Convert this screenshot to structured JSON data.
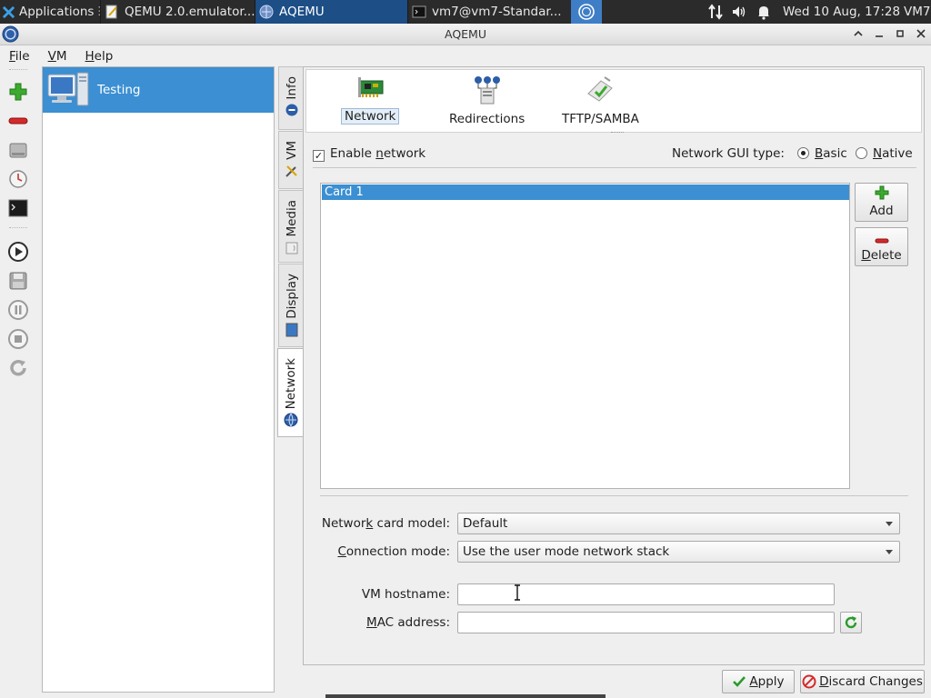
{
  "taskbar": {
    "apps_label": "Applications",
    "apps_extra": "☰",
    "tasks": [
      {
        "label": "QEMU 2.0.emulator..."
      },
      {
        "label": "AQEMU"
      },
      {
        "label": "vm7@vm7-Standar..."
      }
    ],
    "clock": "Wed 10 Aug, 17:28",
    "user": "VM7"
  },
  "window": {
    "title": "AQEMU"
  },
  "menu": {
    "file": {
      "pre": "",
      "key": "F",
      "post": "ile"
    },
    "vm": {
      "pre": "",
      "key": "V",
      "post": "M"
    },
    "help": {
      "pre": "",
      "key": "H",
      "post": "elp"
    }
  },
  "vm_list": {
    "items": [
      {
        "name": "Testing"
      }
    ]
  },
  "tabs": {
    "info": "Info",
    "vm": "VM",
    "media": "Media",
    "display": "Display",
    "network": "Network"
  },
  "subnav": {
    "network": "Network",
    "redirections": "Redirections",
    "tftp": "TFTP/SAMBA"
  },
  "network": {
    "enable_pre": "Enable ",
    "enable_key": "n",
    "enable_post": "etwork",
    "enable_checked": true,
    "gui_type_label": "Network GUI type:",
    "basic_pre": "",
    "basic_key": "B",
    "basic_post": "asic",
    "native_pre": "",
    "native_key": "N",
    "native_post": "ative",
    "selected_gui": "Basic",
    "cards": [
      "Card 1"
    ],
    "add_label": "Add",
    "delete_pre": "",
    "delete_key": "D",
    "delete_post": "elete"
  },
  "form": {
    "card_model_pre": "Networ",
    "card_model_key": "k",
    "card_model_post": " card model:",
    "card_model_value": "Default",
    "conn_mode_pre": "",
    "conn_mode_key": "C",
    "conn_mode_post": "onnection mode:",
    "conn_mode_value": "Use the user mode network stack",
    "hostname_label": "VM hostname:",
    "hostname_value": "",
    "mac_pre": "",
    "mac_key": "M",
    "mac_post": "AC address:",
    "mac_value": ""
  },
  "actions": {
    "apply_pre": "",
    "apply_key": "A",
    "apply_post": "pply",
    "discard_pre": "",
    "discard_key": "D",
    "discard_post": "iscard Changes"
  },
  "colors": {
    "selection": "#3b8fd2",
    "taskbar": "#2b2b2b",
    "active_task": "#1d4e86"
  }
}
